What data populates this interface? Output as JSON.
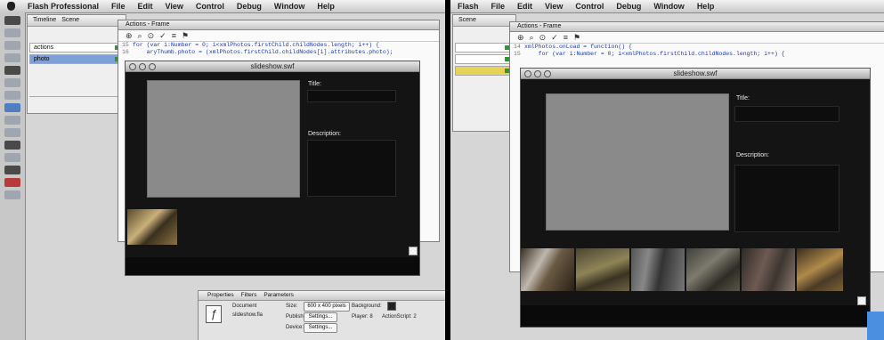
{
  "left": {
    "menu": [
      "Flash Professional",
      "File",
      "Edit",
      "View",
      "Control",
      "Debug",
      "Window",
      "Help"
    ],
    "timeline": {
      "tabs": [
        "Timeline",
        "Scene"
      ],
      "layers": [
        {
          "name": "actions"
        },
        {
          "name": "photo",
          "selected": true
        }
      ]
    },
    "actions_panel": {
      "header": "Actions - Frame",
      "code": [
        {
          "ln": "15",
          "text": "for (var i:Number = 0; i<xmlPhotos.firstChild.childNodes.length; i++) {"
        },
        {
          "ln": "16",
          "text": "    aryThumb.photo = (xmlPhotos.firstChild.childNodes[i].attributes.photo);"
        }
      ]
    },
    "swf_window": {
      "title": "slideshow.swf",
      "labels": {
        "title": "Title:",
        "description": "Description:"
      }
    },
    "properties": {
      "tabs": [
        "Properties",
        "Filters",
        "Parameters"
      ],
      "document_label": "Document",
      "doc_name": "slideshow.fla",
      "size_label": "Size:",
      "size_value": "600 x 400 pixels",
      "background_label": "Background:",
      "publish_label": "Publish:",
      "settings_btn": "Settings...",
      "player_label": "Player: 8",
      "actionscript_label": "ActionScript: 2",
      "device_label": "Device:",
      "device_btn": "Settings..."
    }
  },
  "right": {
    "menu": [
      "Flash",
      "File",
      "Edit",
      "View",
      "Control",
      "Debug",
      "Window",
      "Help"
    ],
    "actions_panel": {
      "header": "Actions - Frame",
      "code": [
        {
          "ln": "14",
          "text": "xmlPhotos.onLoad = function() {"
        },
        {
          "ln": "15",
          "text": "    for (var i:Number = 0; i<xmlPhotos.firstChild.childNodes.length; i++) {"
        }
      ]
    },
    "swf_window": {
      "title": "slideshow.swf",
      "labels": {
        "title": "Title:",
        "description": "Description:"
      }
    },
    "timeline": {
      "tabs": [
        "Timeline",
        "Scene"
      ]
    }
  },
  "colors": {
    "stage_bg": "#141414",
    "photo_placeholder": "#8a8a8a",
    "field_bg": "#0d0d0d",
    "code_blue": "#1a3bb0",
    "layer_selected": "#7ea0d6"
  }
}
